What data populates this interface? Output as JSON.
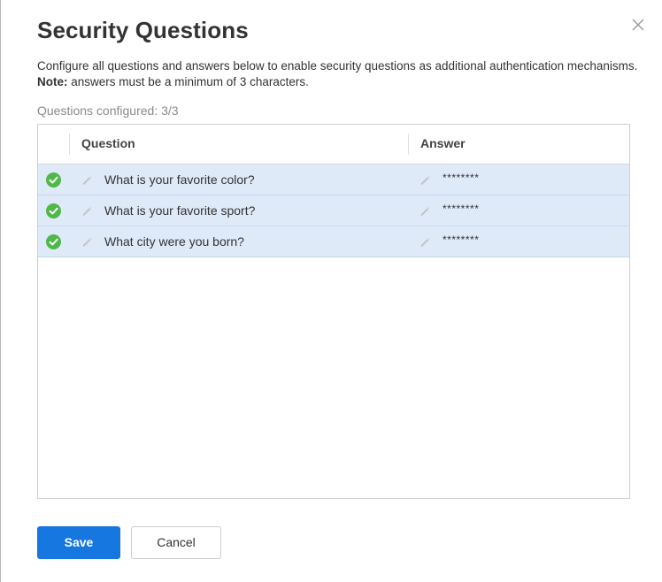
{
  "dialog": {
    "title": "Security Questions",
    "description_prefix": "Configure all questions and answers below to enable security questions as additional authentication mechanisms. ",
    "note_label": "Note:",
    "description_suffix": " answers must be a minimum of 3 characters.",
    "configured_text": "Questions configured: 3/3",
    "close_icon": "close-icon"
  },
  "table": {
    "columns": {
      "question": "Question",
      "answer": "Answer"
    },
    "rows": [
      {
        "status_icon": "check-circle-icon",
        "question": "What is your favorite color?",
        "answer": "********"
      },
      {
        "status_icon": "check-circle-icon",
        "question": "What is your favorite sport?",
        "answer": "********"
      },
      {
        "status_icon": "check-circle-icon",
        "question": "What city were you born?",
        "answer": "********"
      }
    ]
  },
  "buttons": {
    "save_label": "Save",
    "cancel_label": "Cancel"
  },
  "colors": {
    "accent": "#1677e1",
    "row_selected": "#dfeaf9",
    "success": "#4fb848"
  }
}
